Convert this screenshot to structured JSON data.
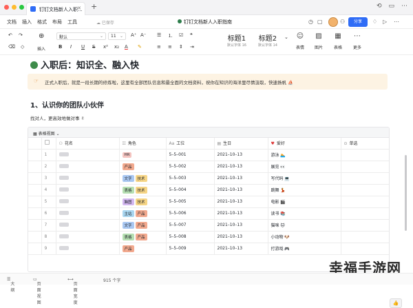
{
  "window": {
    "tab_title": "钉钉文档新人入职...",
    "new_tab": "+",
    "doc_title": "钉钉文档新人入职指南"
  },
  "menu": {
    "items": [
      "文档",
      "插入",
      "格式",
      "布局",
      "工具"
    ],
    "saved": "已保存",
    "share": "分享"
  },
  "toolbar": {
    "insert": "插入",
    "font": "默认",
    "size": "11",
    "style1": {
      "name": "标题1",
      "sub": "默认字体 16"
    },
    "style2": {
      "name": "标题2",
      "sub": "默认字体 14"
    },
    "buttons": [
      {
        "label": "表情",
        "icon": "smile-icon"
      },
      {
        "label": "图片",
        "icon": "image-icon"
      },
      {
        "label": "表格",
        "icon": "table-icon"
      },
      {
        "label": "更多",
        "icon": "more-icon"
      }
    ]
  },
  "doc": {
    "heading": "入职后：知识全、融入快",
    "callout": "正式入职后，就是一段长期的修炼啦，这里有全部团队信息和最全面的文档资料，祝你在知识的海洋里尽情汲取，快速扬帆 ⛵",
    "section": "1、认识你的团队小伙伴",
    "intro": "找对人，更高效地做对事 ✌"
  },
  "table": {
    "view": "表格视图",
    "columns": [
      "花名",
      "角色",
      "工位",
      "生日",
      "爱好",
      "单选"
    ],
    "rows": [
      {
        "n": "1",
        "roles": [
          [
            "HR",
            "#f4c4c0"
          ]
        ],
        "seat": "5–5–001",
        "bday": "2021–10–13",
        "hobby": "游泳 🏊"
      },
      {
        "n": "2",
        "roles": [
          [
            "产品",
            "#f2a98e"
          ]
        ],
        "seat": "5–5–002",
        "bday": "2021–10–13",
        "hobby": "展览 👀"
      },
      {
        "n": "3",
        "roles": [
          [
            "文字",
            "#a9c8f2"
          ],
          [
            "技术",
            "#f6d586"
          ]
        ],
        "seat": "5–5–003",
        "bday": "2021–10–13",
        "hobby": "写代码 💻"
      },
      {
        "n": "4",
        "roles": [
          [
            "表格",
            "#b6dfb2"
          ],
          [
            "技术",
            "#f6d586"
          ]
        ],
        "seat": "5–5–004",
        "bday": "2021–10–13",
        "hobby": "跳舞 💃"
      },
      {
        "n": "5",
        "roles": [
          [
            "脑图",
            "#d4b8f0"
          ],
          [
            "技术",
            "#f6d586"
          ]
        ],
        "seat": "5–5–005",
        "bday": "2021–10–13",
        "hobby": "电影 🎬"
      },
      {
        "n": "6",
        "roles": [
          [
            "主站",
            "#a9d6f0"
          ],
          [
            "产品",
            "#f2a98e"
          ]
        ],
        "seat": "5–5–006",
        "bday": "2021–10–13",
        "hobby": "读书 📚"
      },
      {
        "n": "7",
        "roles": [
          [
            "文字",
            "#a9c8f2"
          ],
          [
            "产品",
            "#f2a98e"
          ]
        ],
        "seat": "5–5–007",
        "bday": "2021–10–13",
        "hobby": "猫咪 🐱"
      },
      {
        "n": "8",
        "roles": [
          [
            "表格",
            "#b6dfb2"
          ],
          [
            "产品",
            "#f2a98e"
          ]
        ],
        "seat": "5–5–008",
        "bday": "2021–10–13",
        "hobby": "小动物 🐶"
      },
      {
        "n": "9",
        "roles": [
          [
            "产品",
            "#f2a98e"
          ]
        ],
        "seat": "5–5–009",
        "bday": "2021–10–13",
        "hobby": "打游戏 🎮"
      }
    ]
  },
  "status": {
    "outline": "大纲",
    "page_view": "页面视图",
    "page_width": "页面宽度",
    "words": "915 个字"
  },
  "watermark": "幸福手游网"
}
